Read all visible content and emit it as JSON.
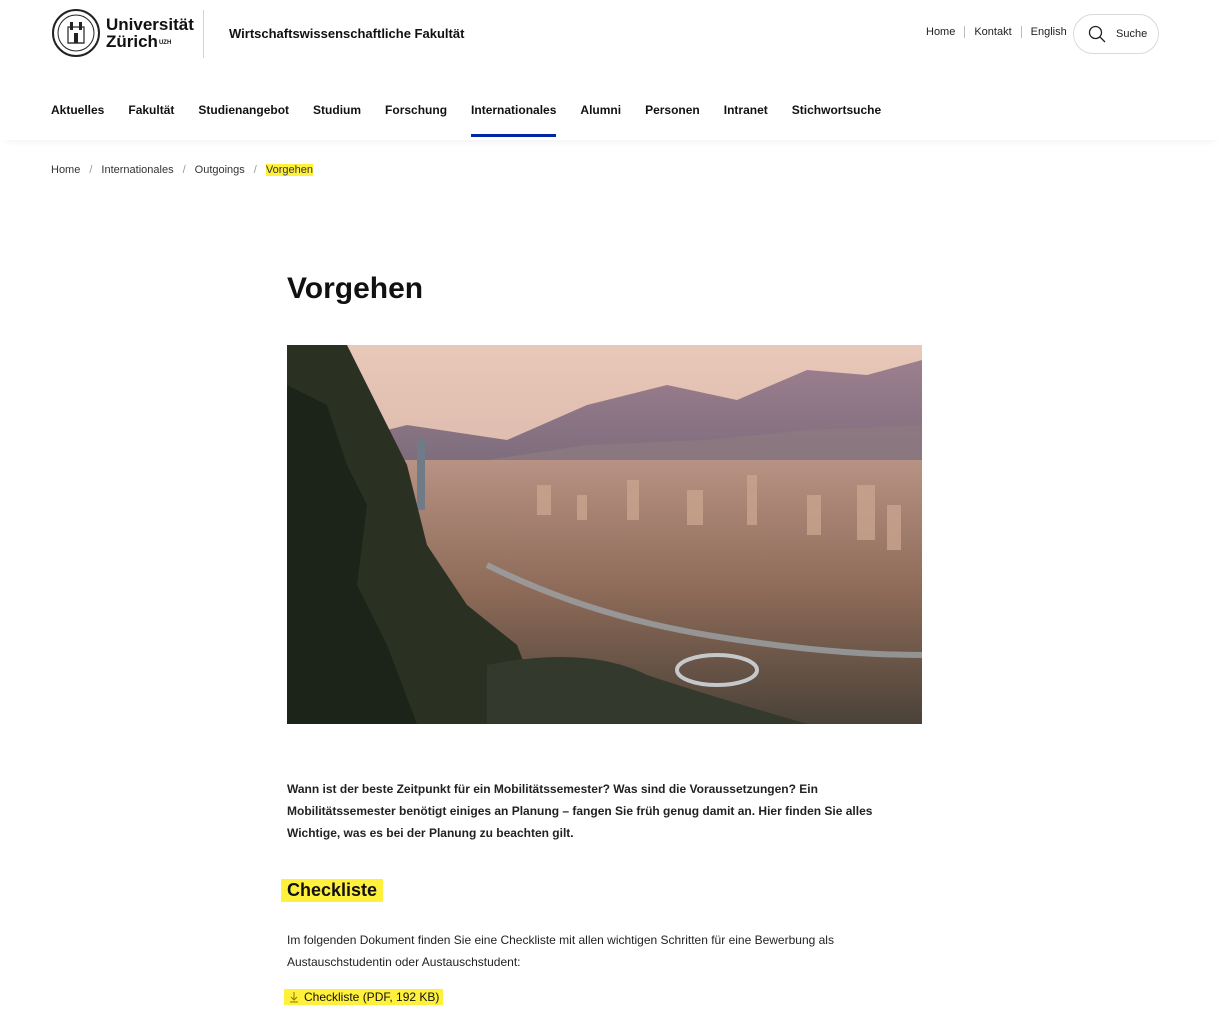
{
  "header": {
    "logo_line1": "Universität",
    "logo_line2": "Zürich",
    "logo_sup": "UZH",
    "faculty": "Wirtschaftswissenschaftliche Fakultät",
    "meta_links": [
      "Home",
      "Kontakt",
      "English"
    ],
    "search_label": "Suche"
  },
  "nav": {
    "items": [
      "Aktuelles",
      "Fakultät",
      "Studienangebot",
      "Studium",
      "Forschung",
      "Internationales",
      "Alumni",
      "Personen",
      "Intranet",
      "Stichwortsuche"
    ],
    "active": "Internationales"
  },
  "breadcrumb": [
    "Home",
    "Internationales",
    "Outgoings",
    "Vorgehen"
  ],
  "content": {
    "title": "Vorgehen",
    "hero_image": "city-mountain-panorama",
    "intro": "Wann ist der beste Zeitpunkt für ein Mobilitätssemester? Was sind die Voraussetzungen? Ein Mobilitätssemester benötigt einiges an Planung – fangen Sie früh genug damit an. Hier finden Sie alles Wichtige, was es bei der Planung zu beachten gilt.",
    "section_title": "Checkliste",
    "section_text": "Im folgenden Dokument finden Sie eine Checkliste mit allen wichtigen Schritten für eine Bewerbung als Austauschstudentin oder Austauschstudent:",
    "download_label": "Checkliste (PDF, 192 KB)"
  },
  "colors": {
    "highlight": "#fff03c",
    "nav_active": "#0028a5"
  },
  "icons": {
    "search": "search-icon",
    "download": "download-icon",
    "seal": "university-seal-icon"
  }
}
